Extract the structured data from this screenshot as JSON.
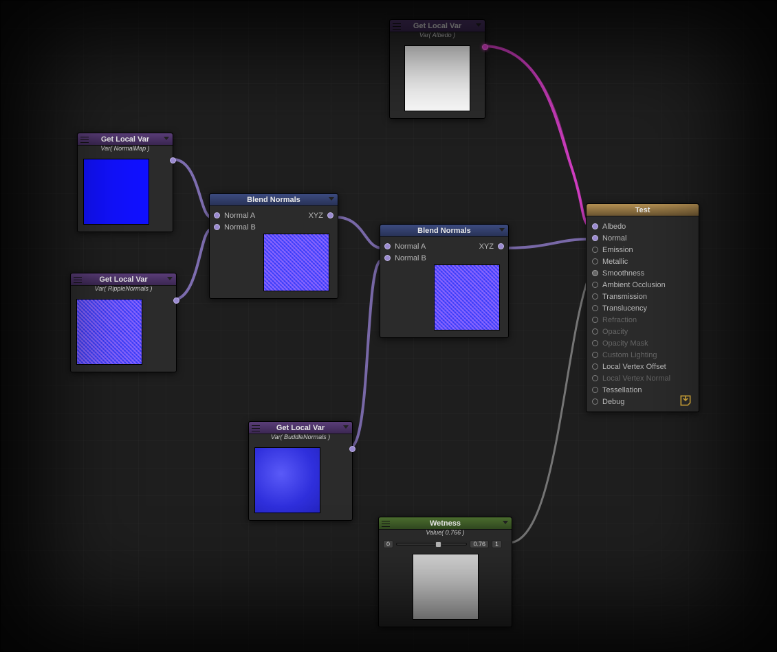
{
  "nodes": {
    "albedo": {
      "title": "Get Local Var",
      "sub": "Var( Albedo )"
    },
    "normal": {
      "title": "Get Local Var",
      "sub": "Var( NormalMap )"
    },
    "ripple": {
      "title": "Get Local Var",
      "sub": "Var( RippleNormals )"
    },
    "buddle": {
      "title": "Get Local Var",
      "sub": "Var( BuddleNormals )"
    },
    "blend1": {
      "title": "Blend Normals",
      "normal_a": "Normal A",
      "normal_b": "Normal B",
      "out": "XYZ"
    },
    "blend2": {
      "title": "Blend Normals",
      "normal_a": "Normal A",
      "normal_b": "Normal B",
      "out": "XYZ"
    },
    "wetness": {
      "title": "Wetness",
      "sub": "Value( 0.766 )",
      "min": "0",
      "max": "1",
      "val": "0.76"
    }
  },
  "master": {
    "title": "Test",
    "pins": [
      {
        "label": "Albedo",
        "state": "fill"
      },
      {
        "label": "Normal",
        "state": "fill"
      },
      {
        "label": "Emission",
        "state": "ring"
      },
      {
        "label": "Metallic",
        "state": "ring"
      },
      {
        "label": "Smoothness",
        "state": "grey"
      },
      {
        "label": "Ambient Occlusion",
        "state": "ring"
      },
      {
        "label": "Transmission",
        "state": "ring"
      },
      {
        "label": "Translucency",
        "state": "ring"
      },
      {
        "label": "Refraction",
        "state": "off"
      },
      {
        "label": "Opacity",
        "state": "off"
      },
      {
        "label": "Opacity Mask",
        "state": "off"
      },
      {
        "label": "Custom Lighting",
        "state": "off"
      },
      {
        "label": "Local Vertex Offset",
        "state": "ring"
      },
      {
        "label": "Local Vertex Normal",
        "state": "off"
      },
      {
        "label": "Tessellation",
        "state": "ring-m"
      },
      {
        "label": "Debug",
        "state": "ring"
      }
    ]
  }
}
